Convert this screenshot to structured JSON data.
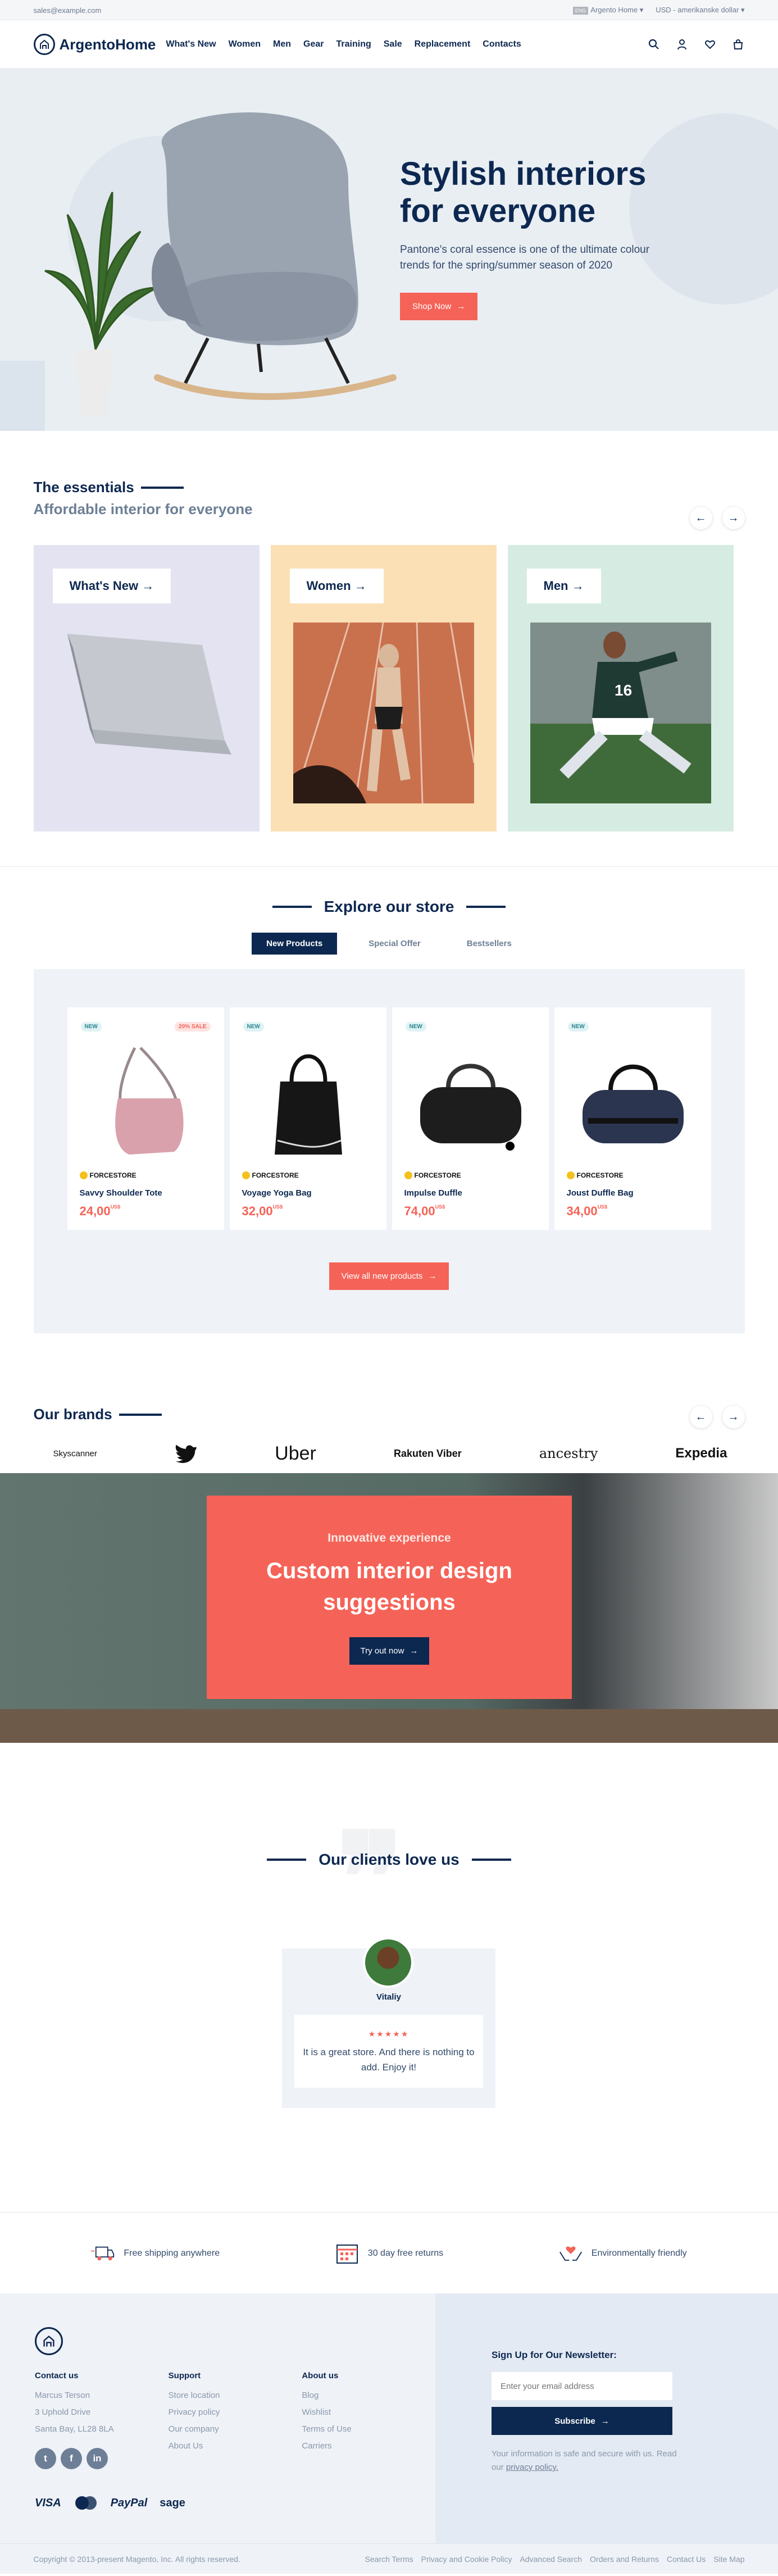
{
  "topbar": {
    "email": "sales@example.com",
    "store_flag": "ENG",
    "store": "Argento Home",
    "currency": "USD - amerikanske dollar"
  },
  "header": {
    "logo": "ArgentoHome",
    "nav": [
      "What's New",
      "Women",
      "Men",
      "Gear",
      "Training",
      "Sale",
      "Replacement",
      "Contacts"
    ],
    "icons": [
      "search-icon",
      "account-icon",
      "wishlist-icon",
      "cart-icon"
    ]
  },
  "hero": {
    "title": "Stylish interiors for everyone",
    "text": "Pantone's coral essence is one of the ultimate colour trends for the spring/summer season of 2020",
    "button": "Shop Now"
  },
  "essentials": {
    "title": "The essentials",
    "subtitle": "Affordable interior for everyone",
    "cards": [
      {
        "label": "What's New",
        "color": "#e3e3f2"
      },
      {
        "label": "Women",
        "color": "#fbe0b5"
      },
      {
        "label": "Men",
        "color": "#d6ece3"
      }
    ]
  },
  "explore": {
    "title": "Explore our store",
    "tabs": [
      "New Products",
      "Special Offer",
      "Bestsellers"
    ],
    "products": [
      {
        "name": "Savvy Shoulder Tote",
        "price": "24,00",
        "currency": "US$",
        "badge": "NEW",
        "sale": "20% SALE",
        "brand": "FORCESTORE"
      },
      {
        "name": "Voyage Yoga Bag",
        "price": "32,00",
        "currency": "US$",
        "badge": "NEW",
        "sale": "",
        "brand": "FORCESTORE"
      },
      {
        "name": "Impulse Duffle",
        "price": "74,00",
        "currency": "US$",
        "badge": "NEW",
        "sale": "",
        "brand": "FORCESTORE"
      },
      {
        "name": "Joust Duffle Bag",
        "price": "34,00",
        "currency": "US$",
        "badge": "NEW",
        "sale": "",
        "brand": "FORCESTORE"
      }
    ],
    "button": "View all new products"
  },
  "brands": {
    "title": "Our brands",
    "logos": [
      "Skyscanner",
      "twitter",
      "Uber",
      "Rakuten Viber",
      "ancestry",
      "Expedia"
    ]
  },
  "banner": {
    "kicker": "Innovative experience",
    "title": "Custom interior design suggestions",
    "button": "Try out now"
  },
  "testimonials": {
    "title": "Our clients love us",
    "name": "Vitaliy",
    "stars": "★★★★★",
    "text": "It is a great store. And there is nothing to add. Enjoy it!"
  },
  "features": [
    "Free shipping anywhere",
    "30 day free returns",
    "Environmentally friendly"
  ],
  "footer": {
    "contact": {
      "title": "Contact us",
      "lines": [
        "Marcus Terson",
        "3 Uphold Drive",
        "Santa Bay, LL28 8LA"
      ]
    },
    "support": {
      "title": "Support",
      "lines": [
        "Store location",
        "Privacy policy",
        "Our company",
        "About Us"
      ]
    },
    "about": {
      "title": "About us",
      "lines": [
        "Blog",
        "Wishlist",
        "Terms of Use",
        "Carriers"
      ]
    },
    "socials": [
      "t",
      "f",
      "in"
    ],
    "payments": [
      "VISA",
      "mastercard",
      "PayPal",
      "sage"
    ],
    "newsletter": {
      "title": "Sign Up for Our Newsletter:",
      "placeholder": "Enter your email address",
      "button": "Subscribe",
      "note": "Your information is safe and secure with us. Read our",
      "link": "privacy policy."
    },
    "copyright": "Copyright © 2013-present Magento, Inc. All rights reserved.",
    "links": [
      "Search Terms",
      "Privacy and Cookie Policy",
      "Advanced Search",
      "Orders and Returns",
      "Contact Us",
      "Site Map"
    ]
  }
}
